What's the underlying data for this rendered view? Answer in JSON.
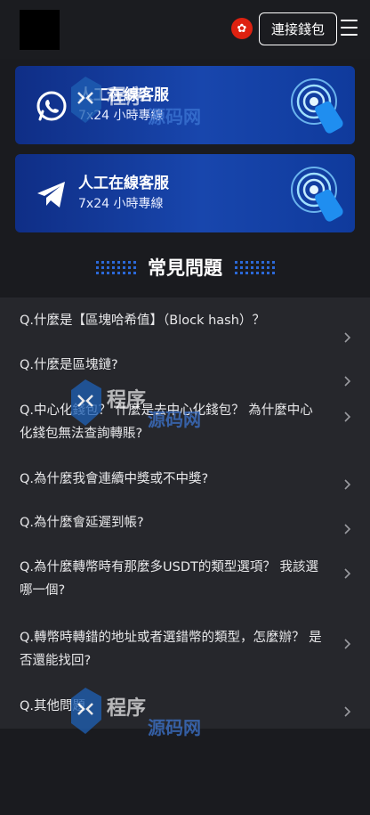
{
  "header": {
    "connect_label": "連接錢包",
    "flag_icon": "hong-kong-flag-icon",
    "menu_icon": "hamburger-menu-icon"
  },
  "services": [
    {
      "icon": "whatsapp-icon",
      "title": "人工在線客服",
      "subtitle": "7x24 小時專線"
    },
    {
      "icon": "telegram-icon",
      "title": "人工在線客服",
      "subtitle": "7x24 小時專線"
    }
  ],
  "faq": {
    "title": "常見問題",
    "items": [
      {
        "question": "Q.什麼是【區塊哈希值】（Block hash）？"
      },
      {
        "question": "Q.什麼是區塊鏈?"
      },
      {
        "question": "Q.中心化錢包？ 什麼是去中心化錢包？ 為什麼中心化錢包無法查詢轉賬?"
      },
      {
        "question": "Q.為什麼我會連續中獎或不中獎?"
      },
      {
        "question": "Q.為什麼會延遲到帳?"
      },
      {
        "question": "Q.為什麼轉幣時有那麼多USDT的類型選項？ 我該選哪一個?"
      },
      {
        "question": "Q.轉幣時轉錯的地址或者選錯幣的類型，怎麼辦？ 是否還能找回?"
      },
      {
        "question": "Q.其他問題"
      }
    ]
  },
  "watermark": {
    "text_a": "程序",
    "text_b": "源码网"
  },
  "colors": {
    "background": "#1a1b1f",
    "card_gradient_start": "#0f2e86",
    "card_gradient_end": "#1846ad",
    "faq_background": "#26272c",
    "flag_red": "#de2110"
  }
}
